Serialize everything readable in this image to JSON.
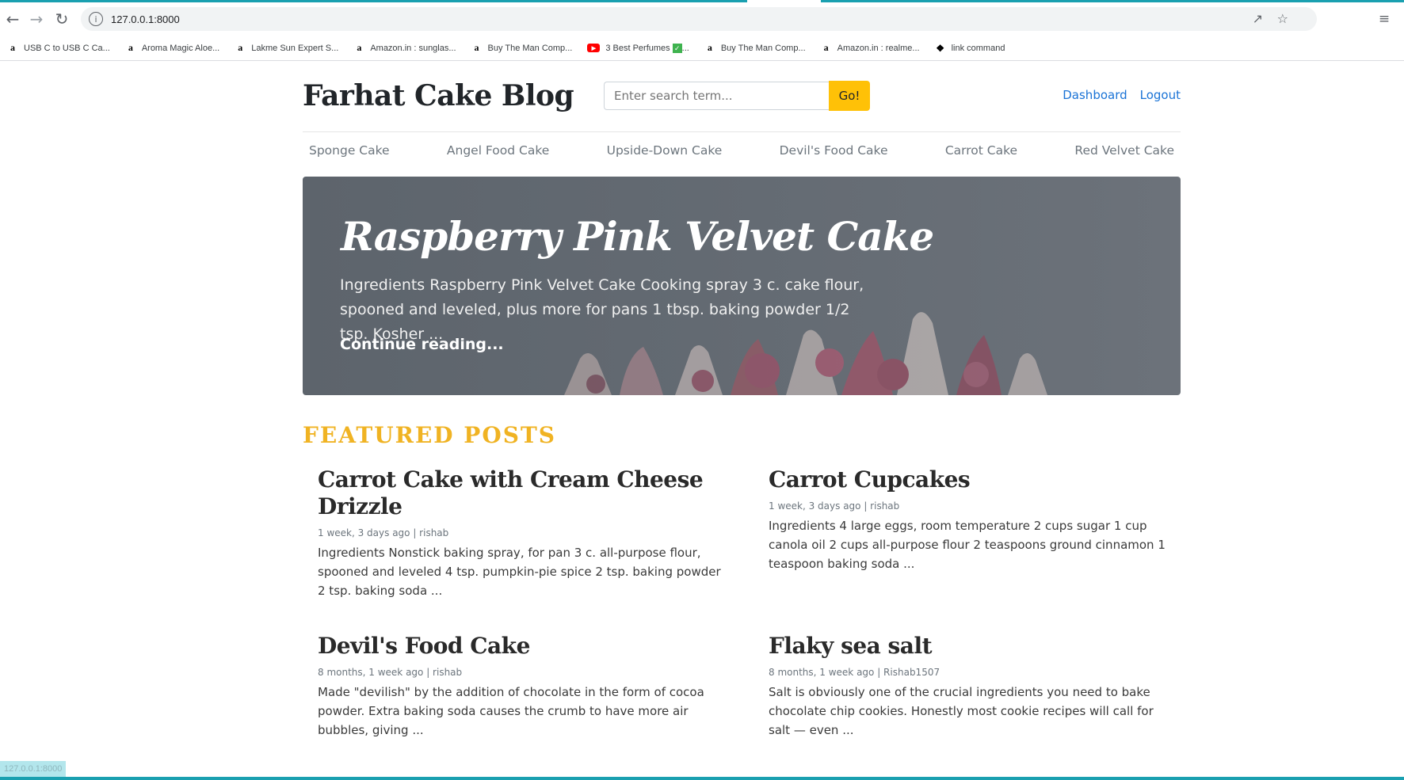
{
  "browser": {
    "url": "127.0.0.1:8000",
    "bookmarks": [
      {
        "icon": "amazon-icon",
        "label": "USB C to USB C Ca..."
      },
      {
        "icon": "amazon-icon",
        "label": "Aroma Magic Aloe..."
      },
      {
        "icon": "amazon-icon",
        "label": "Lakme Sun Expert S..."
      },
      {
        "icon": "amazon-icon",
        "label": "Amazon.in : sunglas..."
      },
      {
        "icon": "amazon-icon",
        "label": "Buy The Man Comp..."
      },
      {
        "icon": "youtube-icon",
        "label": "3 Best Perfumes"
      },
      {
        "icon": "amazon-icon",
        "label": "Buy The Man Comp..."
      },
      {
        "icon": "amazon-icon",
        "label": "Amazon.in : realme..."
      },
      {
        "icon": "link-icon",
        "label": "link command"
      }
    ],
    "status_text": "127.0.0.1:8000"
  },
  "header": {
    "blog_title": "Farhat Cake Blog",
    "search_placeholder": "Enter search term...",
    "search_button": "Go!",
    "links": {
      "dashboard": "Dashboard",
      "logout": "Logout"
    }
  },
  "categories": [
    "Sponge Cake",
    "Angel Food Cake",
    "Upside-Down Cake",
    "Devil's Food Cake",
    "Carrot Cake",
    "Red Velvet Cake"
  ],
  "hero": {
    "title": "Raspberry Pink Velvet Cake",
    "excerpt": "Ingredients Raspberry Pink Velvet Cake Cooking spray 3 c. cake flour, spooned and leveled, plus more for pans 1 tbsp. baking powder 1/2 tsp. Kosher ...",
    "link": "Continue reading..."
  },
  "featured": {
    "heading": "FEATURED POSTS",
    "posts": [
      {
        "title": "Carrot Cake with Cream Cheese Drizzle",
        "meta": "1 week, 3 days ago | rishab",
        "excerpt": "Ingredients Nonstick baking spray, for pan 3 c. all-purpose flour, spooned and leveled 4 tsp. pumpkin-pie spice 2 tsp. baking powder 2 tsp. baking soda ..."
      },
      {
        "title": "Carrot Cupcakes",
        "meta": "1 week, 3 days ago | rishab",
        "excerpt": "Ingredients 4 large eggs, room temperature 2 cups sugar 1 cup canola oil 2 cups all-purpose flour 2 teaspoons ground cinnamon 1 teaspoon baking soda ..."
      },
      {
        "title": "Devil's Food Cake",
        "meta": "8 months, 1 week ago | rishab",
        "excerpt": "Made \"devilish\" by the addition of chocolate in the form of cocoa powder. Extra baking soda causes the crumb to have more air bubbles, giving ..."
      },
      {
        "title": "Flaky sea salt",
        "meta": "8 months, 1 week ago | Rishab1507",
        "excerpt": "Salt is obviously one of the crucial ingredients you need to bake chocolate chip cookies. Honestly most cookie recipes will call for salt — even ..."
      }
    ]
  },
  "colors": {
    "accent": "#ffc107",
    "link": "#1a73d6",
    "featured_heading": "#f0b323",
    "hero_overlay": "#636a72"
  }
}
